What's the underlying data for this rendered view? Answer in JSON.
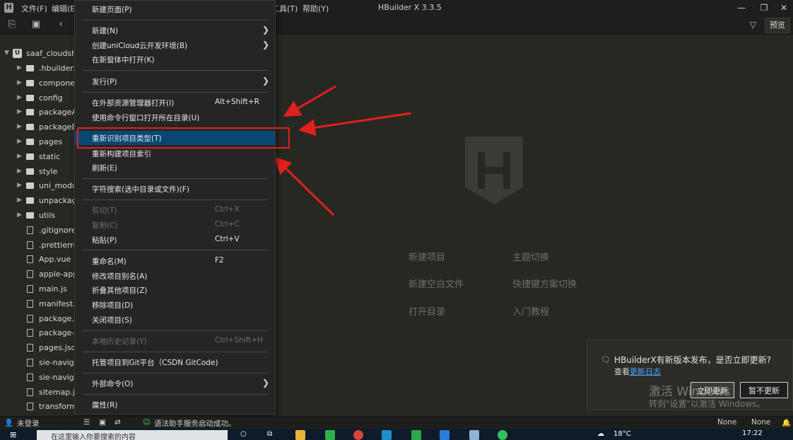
{
  "window": {
    "title": "HBuilder X 3.3.5",
    "menus": [
      "文件(F)",
      "编辑(E)",
      "工具(T)",
      "帮助(Y)"
    ],
    "logo_text": "H"
  },
  "toolbar": {
    "preview_label": "预览"
  },
  "sidebar": {
    "root": {
      "label": "saaf_cloudshop",
      "badge": "U"
    },
    "items": [
      {
        "label": ".hbuilderx",
        "type": "folder"
      },
      {
        "label": "components",
        "type": "folder"
      },
      {
        "label": "config",
        "type": "folder"
      },
      {
        "label": "packageA",
        "type": "folder"
      },
      {
        "label": "packageB",
        "type": "folder"
      },
      {
        "label": "pages",
        "type": "folder"
      },
      {
        "label": "static",
        "type": "folder"
      },
      {
        "label": "style",
        "type": "folder"
      },
      {
        "label": "uni_modules",
        "type": "folder"
      },
      {
        "label": "unpackage",
        "type": "folder"
      },
      {
        "label": "utils",
        "type": "folder"
      },
      {
        "label": ".gitignore",
        "type": "file"
      },
      {
        "label": ".prettierrc",
        "type": "file"
      },
      {
        "label": "App.vue",
        "type": "file"
      },
      {
        "label": "apple-app-site-association",
        "type": "file"
      },
      {
        "label": "main.js",
        "type": "file"
      },
      {
        "label": "manifest.json",
        "type": "file"
      },
      {
        "label": "package.json",
        "type": "file"
      },
      {
        "label": "package-lock.json",
        "type": "file"
      },
      {
        "label": "pages.json",
        "type": "file"
      },
      {
        "label": "sie-navigation",
        "type": "file"
      },
      {
        "label": "sie-navigation",
        "type": "file"
      },
      {
        "label": "sitemap.json",
        "type": "file"
      },
      {
        "label": "transform_",
        "type": "file"
      }
    ]
  },
  "context_menu": {
    "items": [
      {
        "label": "新建页面(P)"
      },
      {
        "label": "新建(N)",
        "submenu": true
      },
      {
        "label": "创建uniCloud云开发环境(B)",
        "submenu": true
      },
      {
        "label": "在新窗体中打开(K)"
      },
      {
        "label": "发行(P)",
        "submenu": true
      },
      {
        "label": "在外部资源管理器打开(I)",
        "shortcut": "Alt+Shift+R"
      },
      {
        "label": "使用命令行窗口打开所在目录(U)"
      },
      {
        "label": "重新识别项目类型(T)",
        "highlight": true
      },
      {
        "label": "重新构建项目索引"
      },
      {
        "label": "刷新(E)"
      },
      {
        "label": "字符搜索(选中目录或文件)(F)"
      },
      {
        "label": "剪切(T)",
        "shortcut": "Ctrl+X",
        "disabled": true
      },
      {
        "label": "复制(C)",
        "shortcut": "Ctrl+C",
        "disabled": true
      },
      {
        "label": "粘贴(P)",
        "shortcut": "Ctrl+V"
      },
      {
        "label": "重命名(M)",
        "shortcut": "F2"
      },
      {
        "label": "修改项目别名(A)"
      },
      {
        "label": "折叠其他项目(Z)"
      },
      {
        "label": "移除项目(D)"
      },
      {
        "label": "关闭项目(S)"
      },
      {
        "label": "本地历史记录(Y)",
        "shortcut": "Ctrl+Shift+H",
        "disabled": true
      },
      {
        "label": "托管项目到Git平台（CSDN GitCode)"
      },
      {
        "label": "外部命令(O)",
        "submenu": true
      },
      {
        "label": "属性(R)"
      }
    ]
  },
  "welcome": {
    "logo_letter": "H",
    "left_links": [
      "新建项目",
      "新建空白文件",
      "打开目录"
    ],
    "right_links": [
      "主题切换",
      "快捷键方案切换",
      "入门教程"
    ]
  },
  "notification": {
    "message": "HBuilderX有新版本发布，是否立即更新?",
    "view_prefix": "查看",
    "changelog_link": "更新日志",
    "update_now": "立即更新",
    "later": "暂不更新"
  },
  "watermark": {
    "line1": "激活 Windows",
    "line2": "转到\"设置\"以激活 Windows。"
  },
  "statusbar": {
    "login": "未登录",
    "syntax_status": "语法助手服务启动成功。",
    "right1": "None",
    "right2": "None"
  },
  "taskbar": {
    "search_placeholder": "在这里输入你要搜索的内容",
    "weather": "18°C",
    "time": "17:22"
  },
  "colors": {
    "highlight": "#094771",
    "annotation": "#e02020",
    "background": "#272822"
  }
}
